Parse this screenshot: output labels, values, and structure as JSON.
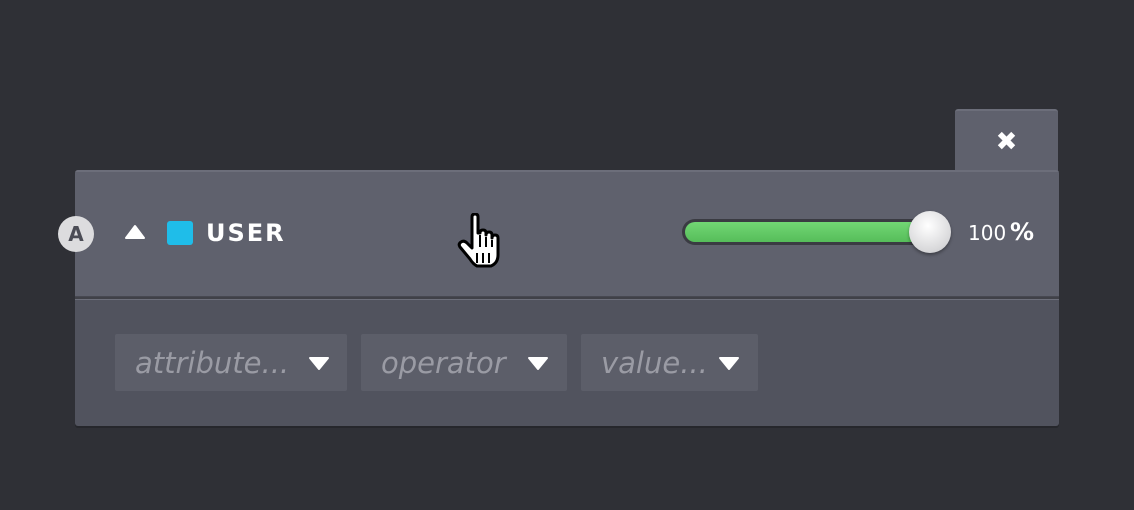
{
  "close_tab": {
    "icon": "close-icon",
    "glyph": "✖"
  },
  "layer": {
    "badge_letter": "A",
    "collapse_icon": "caret-up-icon",
    "color": "#1fbde9",
    "name": "USER",
    "opacity": {
      "value": "100",
      "unit": "%",
      "fraction": 1.0,
      "fill_color": "#62c964"
    }
  },
  "filter": {
    "attribute_placeholder": "attribute...",
    "operator_placeholder": "operator",
    "value_placeholder": "value..."
  },
  "cursor": {
    "icon": "hand-pointer-icon"
  }
}
